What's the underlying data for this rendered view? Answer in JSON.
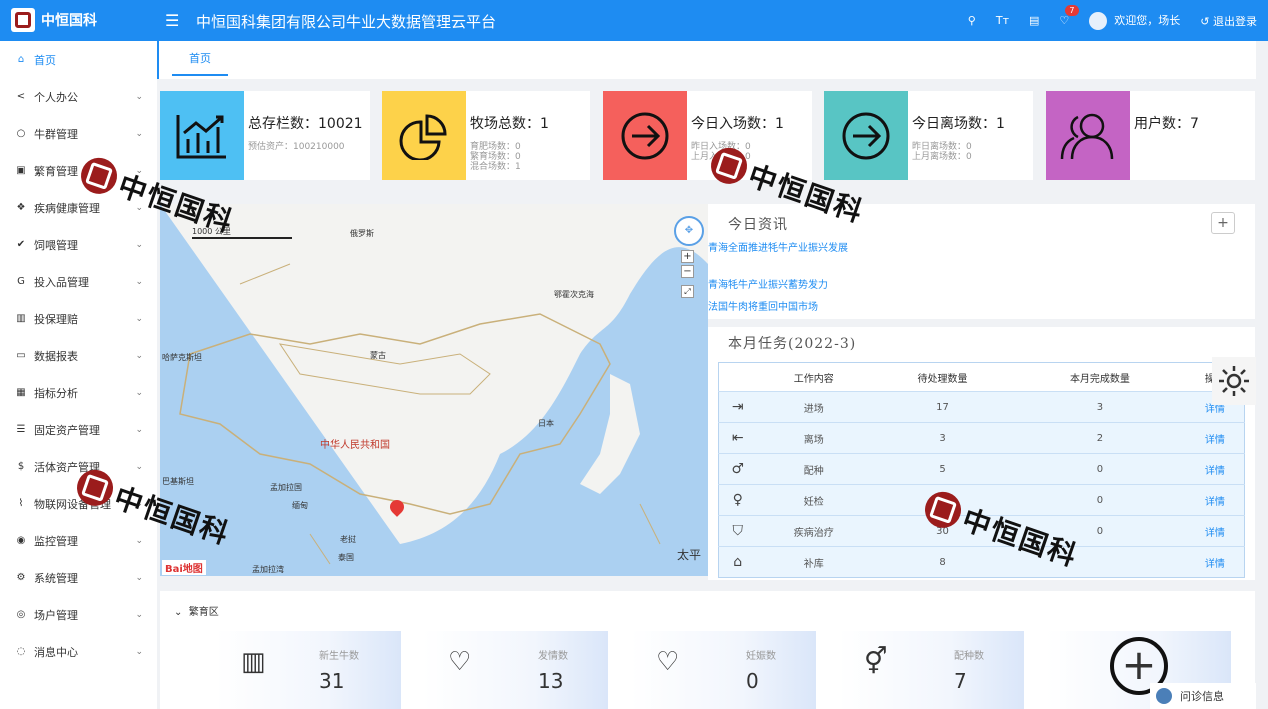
{
  "header": {
    "logo_text": "中恒国科",
    "title": "中恒国科集团有限公司牛业大数据管理云平台",
    "notif_count": "7",
    "welcome": "欢迎您，场长",
    "logout": "退出登录"
  },
  "sidebar": {
    "items": [
      {
        "label": "首页",
        "icon": "home-icon"
      },
      {
        "label": "个人办公",
        "icon": "share-icon"
      },
      {
        "label": "牛群管理",
        "icon": "github-icon"
      },
      {
        "label": "繁育管理",
        "icon": "facebook-icon"
      },
      {
        "label": "疾病健康管理",
        "icon": "dropbox-icon"
      },
      {
        "label": "饲喂管理",
        "icon": "twitter-icon"
      },
      {
        "label": "投入品管理",
        "icon": "google-icon"
      },
      {
        "label": "投保理赔",
        "icon": "chart-square-icon"
      },
      {
        "label": "数据报表",
        "icon": "id-card-icon"
      },
      {
        "label": "指标分析",
        "icon": "grid-icon"
      },
      {
        "label": "固定资产管理",
        "icon": "list-icon"
      },
      {
        "label": "活体资产管理",
        "icon": "dollar-icon"
      },
      {
        "label": "物联网设备管理",
        "icon": "line-chart-icon"
      },
      {
        "label": "监控管理",
        "icon": "eye-icon"
      },
      {
        "label": "系统管理",
        "icon": "cog-icon"
      },
      {
        "label": "场户管理",
        "icon": "instagram-icon"
      },
      {
        "label": "消息中心",
        "icon": "chat-icon"
      }
    ]
  },
  "tabs": {
    "home": "首页"
  },
  "stats": [
    {
      "main": "总存栏数：10021",
      "subs": [
        "预估资产：100210000"
      ],
      "color": "#4ec0f3"
    },
    {
      "main": "牧场总数：1",
      "subs": [
        "育肥场数：0",
        "繁育场数：0",
        "混合场数：1"
      ],
      "color": "#fdd24a"
    },
    {
      "main": "今日入场数：1",
      "subs": [
        "昨日入场数：0",
        "上月入场数：0"
      ],
      "color": "#f5605c"
    },
    {
      "main": "今日离场数：1",
      "subs": [
        "昨日离场数：0",
        "上月离场数：0"
      ],
      "color": "#58c5c4"
    },
    {
      "main": "用户数：7",
      "subs": [],
      "color": "#c464c4"
    }
  ],
  "map": {
    "scale": "1000 公里",
    "labels": {
      "russia": "俄罗斯",
      "okhotsk": "鄂霍次克海",
      "mongolia": "蒙古",
      "kazakhstan": "哈萨克斯坦",
      "china": "中华人民共和国",
      "japan": "日本",
      "pakistan": "巴基斯坦",
      "bangladesh": "孟加拉国",
      "myanmar": "缅甸",
      "laos": "老挝",
      "thailand": "泰国",
      "bay": "孟加拉湾",
      "pacific": "太平"
    },
    "brand": "Bai地图"
  },
  "news": {
    "title": "今日资讯",
    "items": [
      "青海全面推进牦牛产业振兴发展",
      "青海牦牛产业振兴蓄势发力",
      "法国牛肉将重回中国市场"
    ]
  },
  "tasks": {
    "title": "本月任务(2022-3)",
    "headers": [
      "",
      "工作内容",
      "待处理数量",
      "本月完成数量",
      "操作"
    ],
    "rows": [
      {
        "icon": "⇥",
        "name": "进场",
        "pending": "17",
        "done": "3",
        "action": "详情"
      },
      {
        "icon": "⇤",
        "name": "离场",
        "pending": "3",
        "done": "2",
        "action": "详情"
      },
      {
        "icon": "♂",
        "name": "配种",
        "pending": "5",
        "done": "0",
        "action": "详情"
      },
      {
        "icon": "♀",
        "name": "妊检",
        "pending": "",
        "done": "0",
        "action": "详情"
      },
      {
        "icon": "⛉",
        "name": "疾病治疗",
        "pending": "30",
        "done": "0",
        "action": "详情"
      },
      {
        "icon": "⌂",
        "name": "补库",
        "pending": "8",
        "done": "",
        "action": "详情"
      }
    ]
  },
  "breeding": {
    "title": "繁育区",
    "cards": [
      {
        "label": "新生牛数",
        "value": "31"
      },
      {
        "label": "发情数",
        "value": "13"
      },
      {
        "label": "妊娠数",
        "value": "0"
      },
      {
        "label": "配种数",
        "value": "7"
      },
      {
        "label": "",
        "value": ""
      }
    ]
  },
  "consult": {
    "label": "问诊信息"
  },
  "watermark": "中恒国科"
}
